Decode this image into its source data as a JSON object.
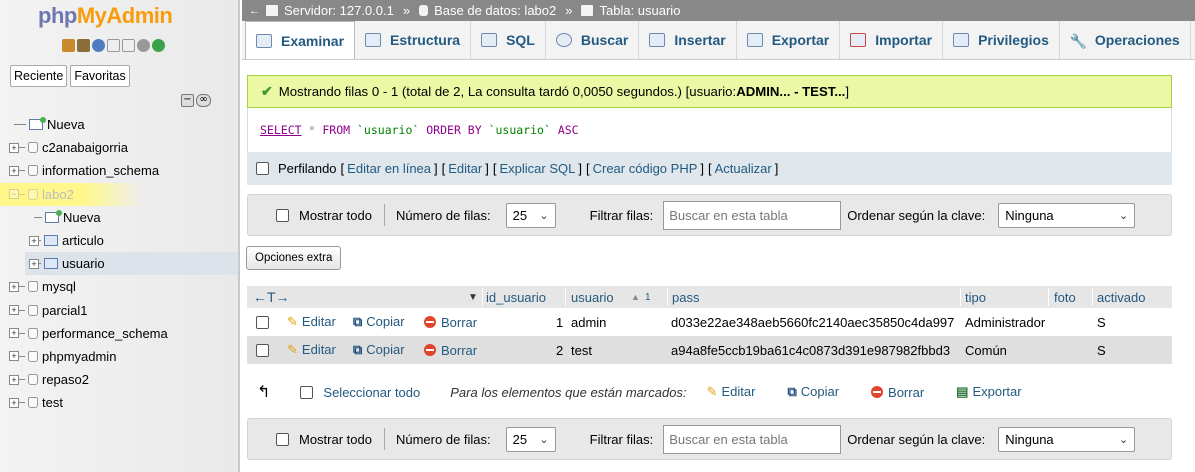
{
  "nav": {
    "logo_php": "php",
    "logo_myadmin": "MyAdmin",
    "tab_recent": "Reciente",
    "tab_favorites": "Favoritas",
    "tree": [
      {
        "label": "Nueva",
        "level": 0,
        "kind": "new"
      },
      {
        "label": "c2anabaigorria",
        "level": 0,
        "kind": "db"
      },
      {
        "label": "information_schema",
        "level": 0,
        "kind": "db"
      },
      {
        "label": "labo2",
        "level": 0,
        "kind": "db",
        "highlighted": true
      },
      {
        "label": "Nueva",
        "level": 1,
        "kind": "new"
      },
      {
        "label": "articulo",
        "level": 1,
        "kind": "table"
      },
      {
        "label": "usuario",
        "level": 1,
        "kind": "table",
        "selected": true
      },
      {
        "label": "mysql",
        "level": 0,
        "kind": "db"
      },
      {
        "label": "parcial1",
        "level": 0,
        "kind": "db"
      },
      {
        "label": "performance_schema",
        "level": 0,
        "kind": "db"
      },
      {
        "label": "phpmyadmin",
        "level": 0,
        "kind": "db"
      },
      {
        "label": "repaso2",
        "level": 0,
        "kind": "db"
      },
      {
        "label": "test",
        "level": 0,
        "kind": "db"
      }
    ]
  },
  "breadcrumb": {
    "server": "Servidor: 127.0.0.1",
    "database": "Base de datos: labo2",
    "table": "Tabla: usuario",
    "sep": "»"
  },
  "tabs": [
    "Examinar",
    "Estructura",
    "SQL",
    "Buscar",
    "Insertar",
    "Exportar",
    "Importar",
    "Privilegios",
    "Operaciones"
  ],
  "success": {
    "text": "Mostrando filas 0 - 1 (total de 2, La consulta tardó 0,0050 segundos.) [usuario: ",
    "bold": "ADMIN... - TEST...",
    "end": "]"
  },
  "sql": {
    "select": "SELECT",
    "star": "*",
    "from": "FROM",
    "table": "`usuario`",
    "order": "ORDER BY",
    "col": "`usuario`",
    "asc": "ASC"
  },
  "profile": {
    "label": "Perfilando",
    "links": [
      "Editar en línea",
      "Editar",
      "Explicar SQL",
      "Crear código PHP",
      "Actualizar"
    ]
  },
  "navbar": {
    "show_all": "Mostrar todo",
    "rows_label": "Número de filas:",
    "rows_value": "25",
    "filter_label": "Filtrar filas:",
    "filter_placeholder": "Buscar en esta tabla",
    "sort_label": "Ordenar según la clave:",
    "sort_value": "Ninguna"
  },
  "extra_options": "Opciones extra",
  "table": {
    "headers": [
      "id_usuario",
      "usuario",
      "pass",
      "tipo",
      "foto",
      "activado"
    ],
    "sort_indicator": "1",
    "actions": {
      "edit": "Editar",
      "copy": "Copiar",
      "delete": "Borrar"
    },
    "rows": [
      {
        "id": "1",
        "usuario": "admin",
        "pass": "d033e22ae348aeb5660fc2140aec35850c4da997",
        "tipo": "Administrador",
        "foto": "",
        "activado": "S"
      },
      {
        "id": "2",
        "usuario": "test",
        "pass": "a94a8fe5ccb19ba61c4c0873d391e987982fbbd3",
        "tipo": "Común",
        "foto": "",
        "activado": "S"
      }
    ]
  },
  "bulk": {
    "select_all": "Seleccionar todo",
    "marked": "Para los elementos que están marcados:",
    "edit": "Editar",
    "copy": "Copiar",
    "delete": "Borrar",
    "export": "Exportar"
  },
  "colors": {
    "link": "#235a81",
    "success_bg": "#ebf8a4",
    "logo_blue": "#6c78af",
    "logo_orange": "#f89c0e"
  }
}
